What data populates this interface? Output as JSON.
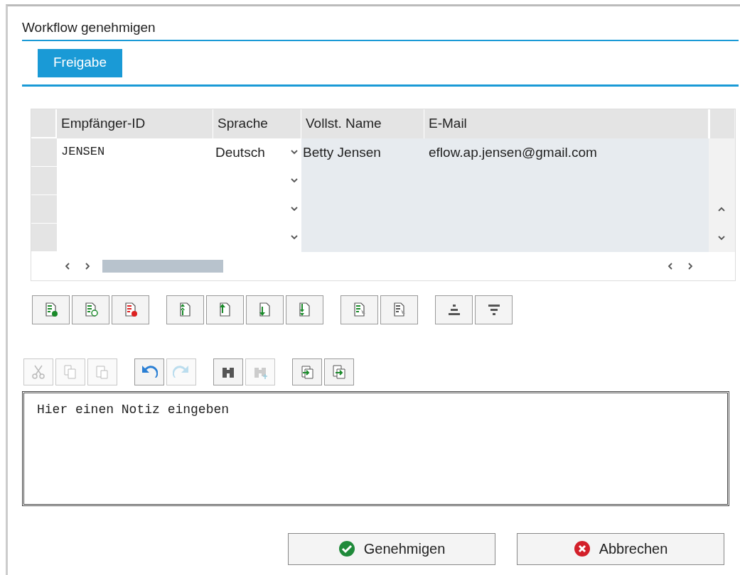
{
  "window": {
    "title": "Workflow genehmigen"
  },
  "tabs": [
    {
      "label": "Freigabe",
      "selected": true
    }
  ],
  "table": {
    "columns": [
      "Empfänger-ID",
      "Sprache",
      "Vollst. Name",
      "E-Mail"
    ],
    "rows": [
      {
        "id": "JENSEN",
        "language": "Deutsch",
        "name": "Betty Jensen",
        "email": "eflow.ap.jensen@gmail.com"
      },
      {
        "id": "",
        "language": "",
        "name": "",
        "email": ""
      },
      {
        "id": "",
        "language": "",
        "name": "",
        "email": ""
      },
      {
        "id": "",
        "language": "",
        "name": "",
        "email": ""
      }
    ]
  },
  "table_toolbar": [
    [
      {
        "kind": "add-row",
        "disabled": false
      },
      {
        "kind": "insert-row",
        "disabled": false
      },
      {
        "kind": "delete-row",
        "disabled": false
      }
    ],
    [
      {
        "kind": "top",
        "disabled": false
      },
      {
        "kind": "up",
        "disabled": false
      },
      {
        "kind": "down",
        "disabled": false
      },
      {
        "kind": "bottom",
        "disabled": false
      }
    ],
    [
      {
        "kind": "select-all",
        "disabled": false
      },
      {
        "kind": "deselect-all",
        "disabled": false
      }
    ],
    [
      {
        "kind": "sort-asc",
        "disabled": false
      },
      {
        "kind": "sort-desc",
        "disabled": false
      }
    ]
  ],
  "editor_toolbar": [
    [
      {
        "kind": "cut",
        "disabled": true
      },
      {
        "kind": "copy",
        "disabled": true
      },
      {
        "kind": "paste",
        "disabled": true
      }
    ],
    [
      {
        "kind": "undo",
        "disabled": false
      },
      {
        "kind": "redo",
        "disabled": true
      }
    ],
    [
      {
        "kind": "find",
        "disabled": false
      },
      {
        "kind": "find-next",
        "disabled": true
      }
    ],
    [
      {
        "kind": "import",
        "disabled": false
      },
      {
        "kind": "export",
        "disabled": false
      }
    ]
  ],
  "note": {
    "placeholder": "Hier einen Notiz eingeben"
  },
  "buttons": [
    {
      "kind": "approve",
      "label": "Genehmigen"
    },
    {
      "kind": "cancel",
      "label": "Abbrechen"
    }
  ]
}
